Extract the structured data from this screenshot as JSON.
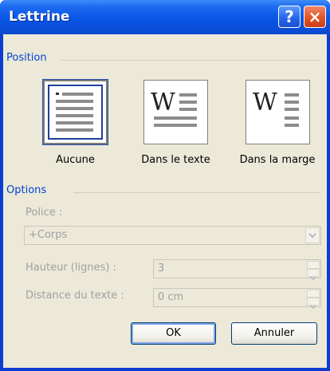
{
  "window": {
    "title": "Lettrine",
    "help_glyph": "?",
    "close_glyph": "×"
  },
  "position_group": {
    "label": "Position",
    "options": [
      {
        "label": "Aucune",
        "selected": true
      },
      {
        "label": "Dans le texte",
        "selected": false
      },
      {
        "label": "Dans la marge",
        "selected": false
      }
    ],
    "drop_letter": "W"
  },
  "options_group": {
    "label": "Options",
    "font_label": "Police :",
    "font_value": "+Corps",
    "height_label": "Hauteur (lignes) :",
    "height_value": "3",
    "distance_label": "Distance du texte :",
    "distance_value": "0 cm"
  },
  "buttons": {
    "ok": "OK",
    "cancel": "Annuler"
  },
  "colors": {
    "titlebar": "#0954e5",
    "group_label": "#0046d5",
    "client": "#ece9d8",
    "disabled_text": "#a0a0a0"
  }
}
